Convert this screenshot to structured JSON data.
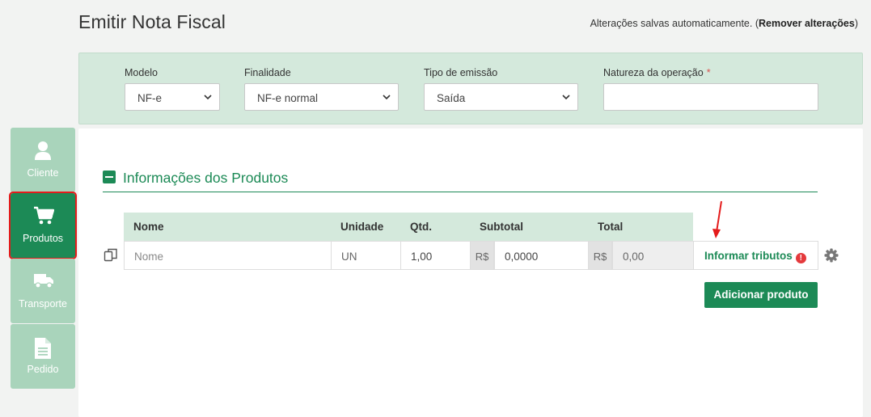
{
  "header": {
    "title": "Emitir Nota Fiscal",
    "autosave_text": "Alterações salvas automaticamente. (",
    "remove_link": "Remover alterações",
    "autosave_close": ")"
  },
  "filters": {
    "modelo": {
      "label": "Modelo",
      "value": "NF-e"
    },
    "finalidade": {
      "label": "Finalidade",
      "value": "NF-e normal"
    },
    "tipo_emissao": {
      "label": "Tipo de emissão",
      "value": "Saída"
    },
    "natureza": {
      "label": "Natureza da operação",
      "required_mark": "*",
      "value": ""
    }
  },
  "sidebar": {
    "items": [
      {
        "label": "Cliente",
        "icon": "user-icon"
      },
      {
        "label": "Produtos",
        "icon": "cart-icon",
        "active": true
      },
      {
        "label": "Transporte",
        "icon": "truck-icon"
      },
      {
        "label": "Pedido",
        "icon": "document-icon"
      }
    ]
  },
  "products_section": {
    "title": "Informações dos Produtos",
    "columns": [
      "Nome",
      "Unidade",
      "Qtd.",
      "Subtotal",
      "Total"
    ],
    "row": {
      "nome_placeholder": "Nome",
      "unidade": "UN",
      "qtd": "1,00",
      "currency": "R$",
      "subtotal": "0,0000",
      "total": "0,00"
    },
    "tax_link": "Informar tributos",
    "alert_glyph": "!",
    "add_button": "Adicionar produto"
  },
  "colors": {
    "brand_green": "#1c8a56",
    "panel_green": "#d4e9dc",
    "sidebar_inactive": "#a9d4bb",
    "alert_red": "#e4393c"
  }
}
